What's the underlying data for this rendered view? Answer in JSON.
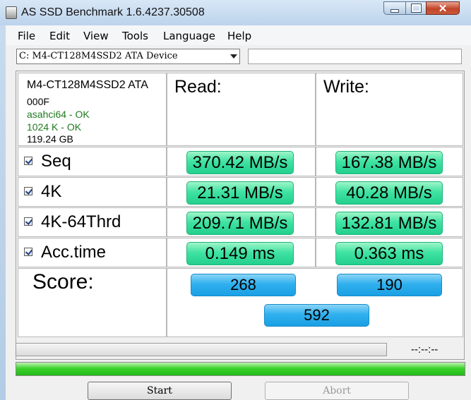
{
  "window": {
    "title": "AS SSD Benchmark 1.6.4237.30508"
  },
  "menu": [
    "File",
    "Edit",
    "View",
    "Tools",
    "Language",
    "Help"
  ],
  "drive": {
    "selected": "C: M4-CT128M4SSD2 ATA Device",
    "info_value": ""
  },
  "device": {
    "name": "M4-CT128M4SSD2 ATA",
    "firmware": "000F",
    "driver_status": "asahci64 - OK",
    "alignment_status": "1024 K - OK",
    "size": "119.24 GB"
  },
  "headers": {
    "read": "Read:",
    "write": "Write:"
  },
  "rows": [
    {
      "label": "Seq",
      "checked": true,
      "read": "370.42 MB/s",
      "write": "167.38 MB/s"
    },
    {
      "label": "4K",
      "checked": true,
      "read": "21.31 MB/s",
      "write": "40.28 MB/s"
    },
    {
      "label": "4K-64Thrd",
      "checked": true,
      "read": "209.71 MB/s",
      "write": "132.81 MB/s"
    },
    {
      "label": "Acc.time",
      "checked": true,
      "read": "0.149 ms",
      "write": "0.363 ms"
    }
  ],
  "score": {
    "label": "Score:",
    "read": "268",
    "write": "190",
    "total": "592"
  },
  "status": {
    "progress_fraction": 0,
    "elapsed": "--:--:--",
    "overall_fraction": 1
  },
  "buttons": {
    "start": "Start",
    "abort": "Abort"
  },
  "colors": {
    "result_green": "#3fe3a2",
    "score_blue": "#30b0ee",
    "progress_green": "#3bd42b",
    "status_ok": "#1f7a1f"
  }
}
